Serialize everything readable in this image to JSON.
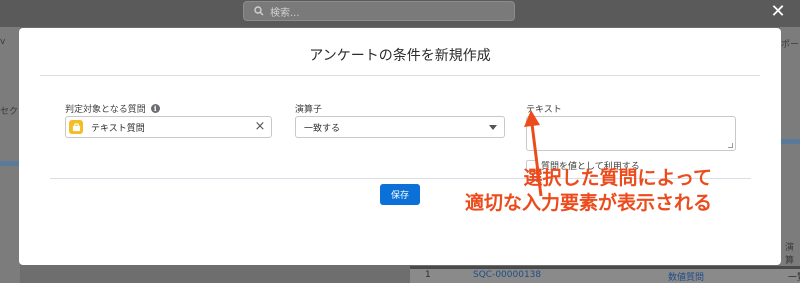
{
  "background": {
    "search_placeholder": "検索...",
    "left_tab_fragment": "v",
    "left_text_fragment": "セクシ",
    "right_tab_fragment": "ポート",
    "right_col_fragment": "演算",
    "table_row": {
      "index": "1",
      "record_id": "SQC-00000138",
      "type": "数値質問",
      "op": "一覧"
    }
  },
  "modal": {
    "title": "アンケートの条件を新規作成",
    "fields": {
      "target_label": "判定対象となる質問",
      "target_value": "テキスト質問",
      "operator_label": "演算子",
      "operator_value": "一致する",
      "text_label": "テキスト",
      "checkbox_label": "質問を値として利用する"
    },
    "save_label": "保存"
  },
  "annotation": {
    "line1": "選択した質問によって",
    "line2": "適切な入力要素が表示される",
    "color": "#ec4b1c"
  },
  "colors": {
    "primary_button": "#0b71d9",
    "pill_icon": "#f4bc25",
    "overlay": "#6e6e6e"
  }
}
